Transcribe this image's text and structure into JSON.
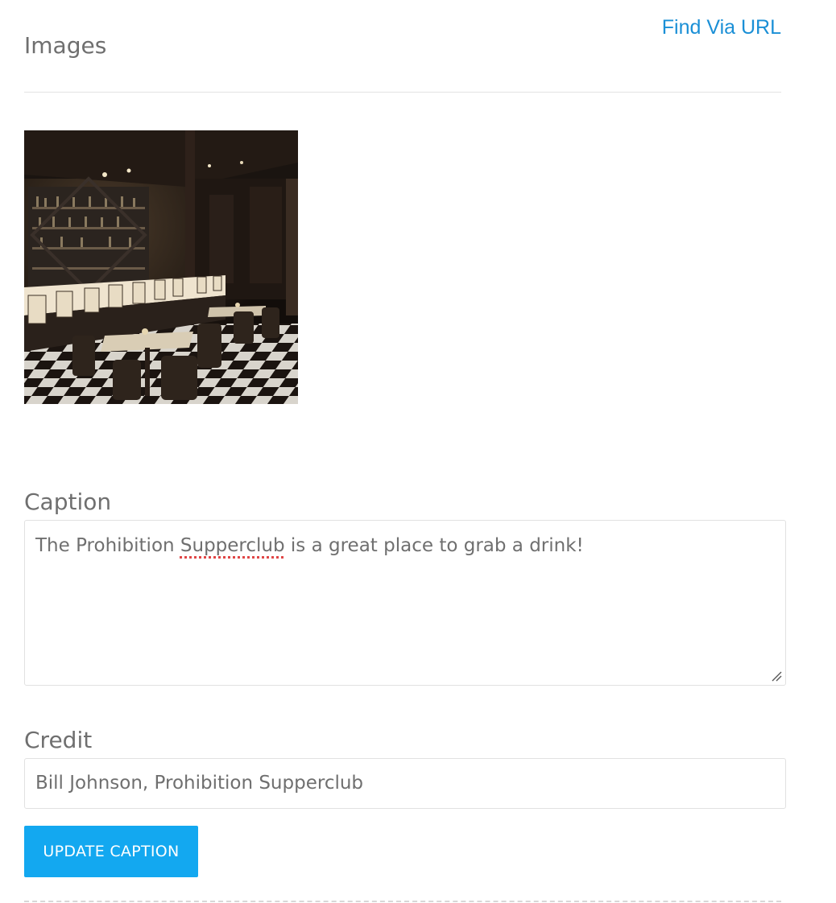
{
  "images_section": {
    "title": "Images",
    "find_via_url_label": "Find Via URL"
  },
  "image": {
    "icon": "restaurant-photo"
  },
  "caption": {
    "label": "Caption",
    "value_before": "The Prohibition ",
    "value_misspelled": "Supperclub",
    "value_after": " is a great place to grab a drink!"
  },
  "credit": {
    "label": "Credit",
    "value": "Bill Johnson, Prohibition Supperclub"
  },
  "actions": {
    "update_caption_label": "UPDATE CAPTION"
  },
  "colors": {
    "link": "#1a8fd6",
    "button": "#13a8f0",
    "label_text": "#6f6f6f",
    "border": "#e1e1e1",
    "spellcheck": "#e04646"
  }
}
